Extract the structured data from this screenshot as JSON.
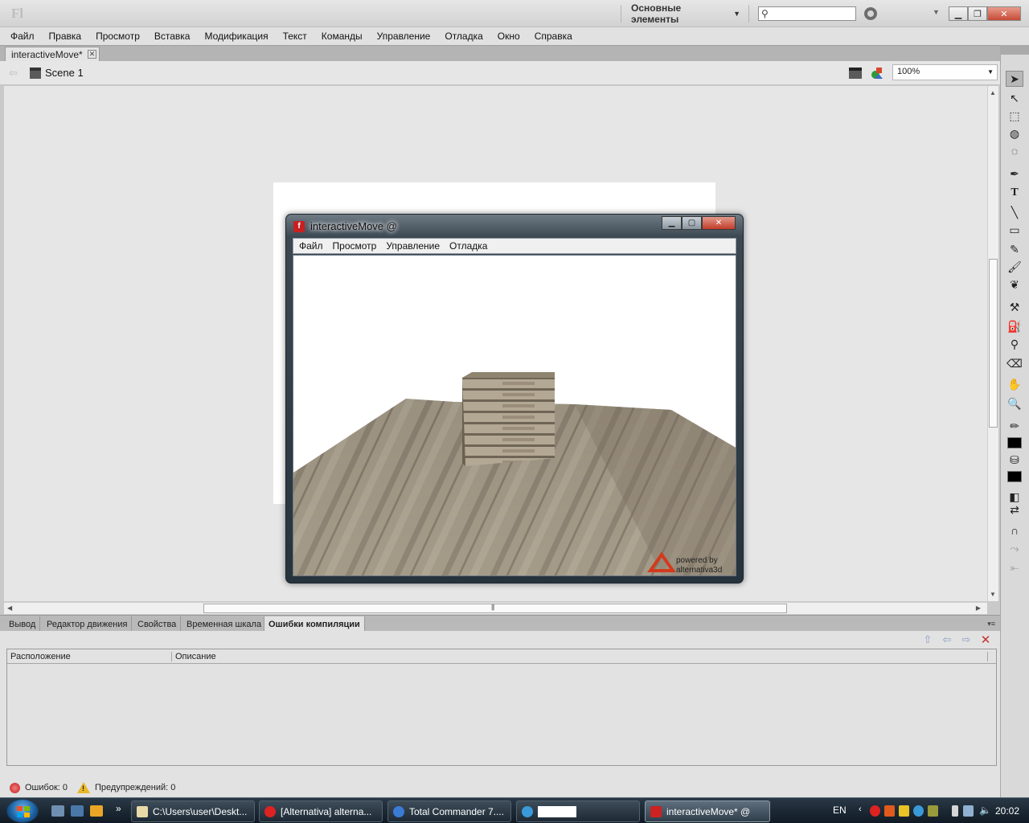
{
  "app": {
    "logo": "Fl",
    "workspace": "Основные элементы",
    "search_placeholder": ""
  },
  "menu": [
    "Файл",
    "Правка",
    "Просмотр",
    "Вставка",
    "Модификация",
    "Текст",
    "Команды",
    "Управление",
    "Отладка",
    "Окно",
    "Справка"
  ],
  "document": {
    "tab_label": "interactiveMove*",
    "scene_label": "Scene 1",
    "zoom": "100%"
  },
  "player": {
    "title": "interactiveMove @",
    "menu": [
      "Файл",
      "Просмотр",
      "Управление",
      "Отладка"
    ],
    "badge_line1": "powered by",
    "badge_line2": "alternativa3d"
  },
  "panel": {
    "tabs": [
      "Вывод",
      "Редактор движения",
      "Свойства",
      "Временная шкала",
      "Ошибки компиляции"
    ],
    "active_tab": "Ошибки компиляции",
    "columns": [
      "Расположение",
      "Описание"
    ],
    "errors_label": "Ошибок: 0",
    "warnings_label": "Предупреждений: 0"
  },
  "taskbar": {
    "items": [
      {
        "label": "C:\\Users\\user\\Deskt...",
        "icon_color": "#e8d9a8"
      },
      {
        "label": "[Alternativa] alterna...",
        "icon_color": "#d22"
      },
      {
        "label": "Total Commander 7....",
        "icon_color": "#3a7bd5"
      },
      {
        "label": "",
        "icon_color": "#3a9ad9"
      },
      {
        "label": "interactiveMove* @",
        "icon_color": "#c22"
      }
    ],
    "language": "EN",
    "clock": "20:02"
  }
}
